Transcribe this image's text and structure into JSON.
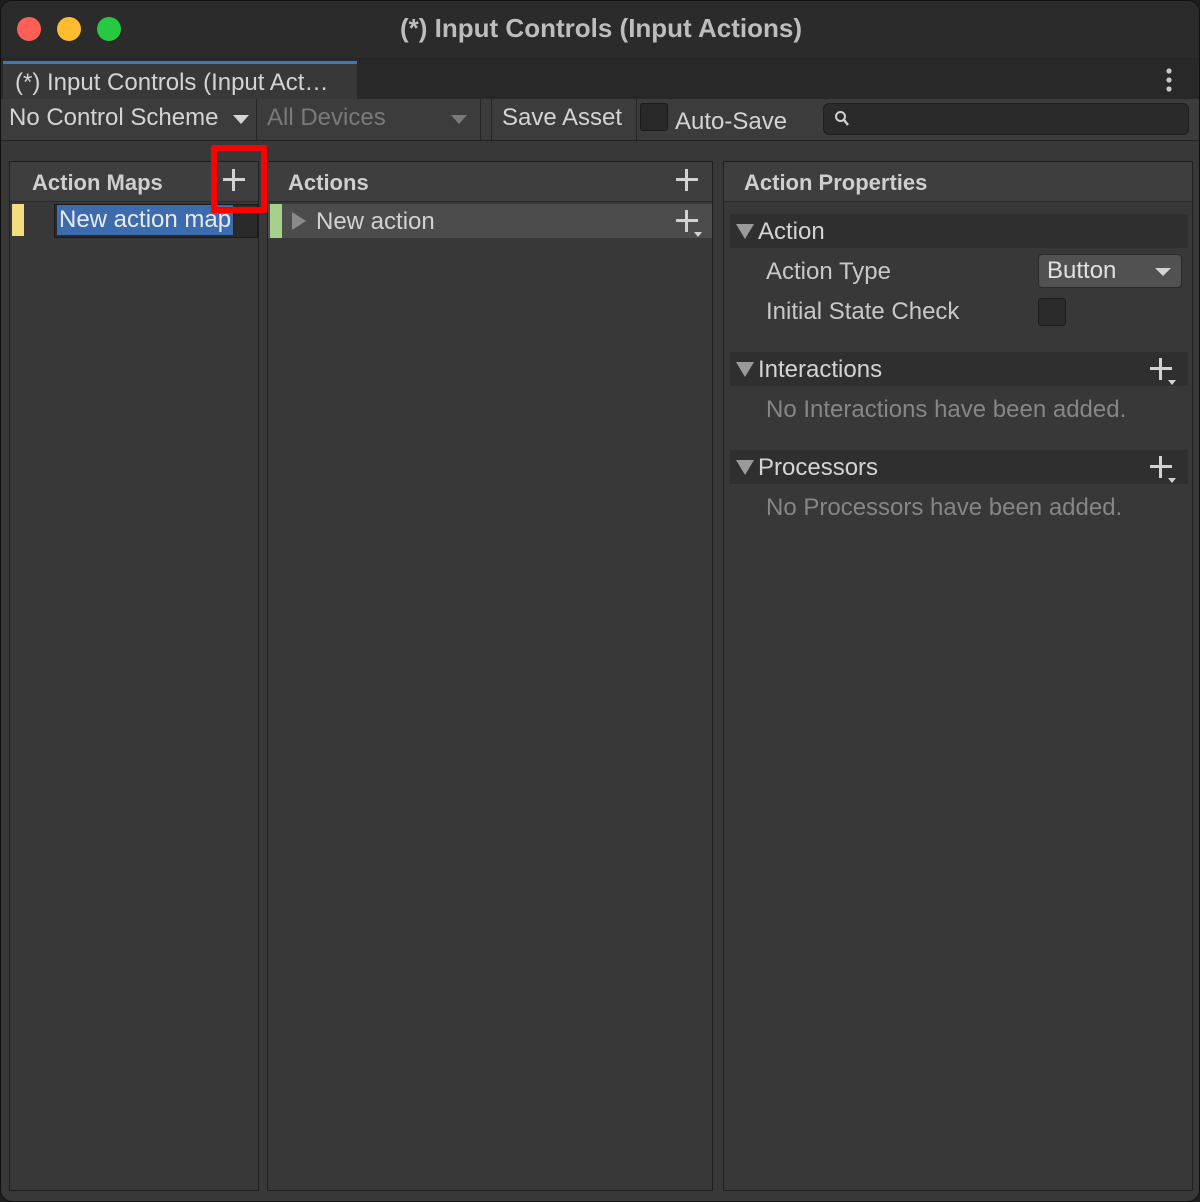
{
  "window": {
    "title": "(*) Input Controls (Input Actions)"
  },
  "tab": {
    "label": "(*) Input Controls (Input Act…"
  },
  "toolbar": {
    "control_scheme": "No Control Scheme",
    "devices": "All Devices",
    "save_label": "Save Asset",
    "autosave_label": "Auto-Save",
    "search_value": ""
  },
  "action_maps": {
    "title": "Action Maps",
    "items": [
      {
        "label": "New action map"
      }
    ]
  },
  "actions": {
    "title": "Actions",
    "items": [
      {
        "label": "New action"
      }
    ]
  },
  "properties": {
    "title": "Action Properties",
    "action_section": "Action",
    "action_type_label": "Action Type",
    "action_type_value": "Button",
    "initial_state_label": "Initial State Check",
    "interactions_section": "Interactions",
    "interactions_empty": "No Interactions have been added.",
    "processors_section": "Processors",
    "processors_empty": "No Processors have been added."
  },
  "colors": {
    "map_stripe": "#f2dd7f",
    "action_stripe": "#a6d18a",
    "selection": "#3c6cad",
    "highlight": "#ff0000"
  }
}
